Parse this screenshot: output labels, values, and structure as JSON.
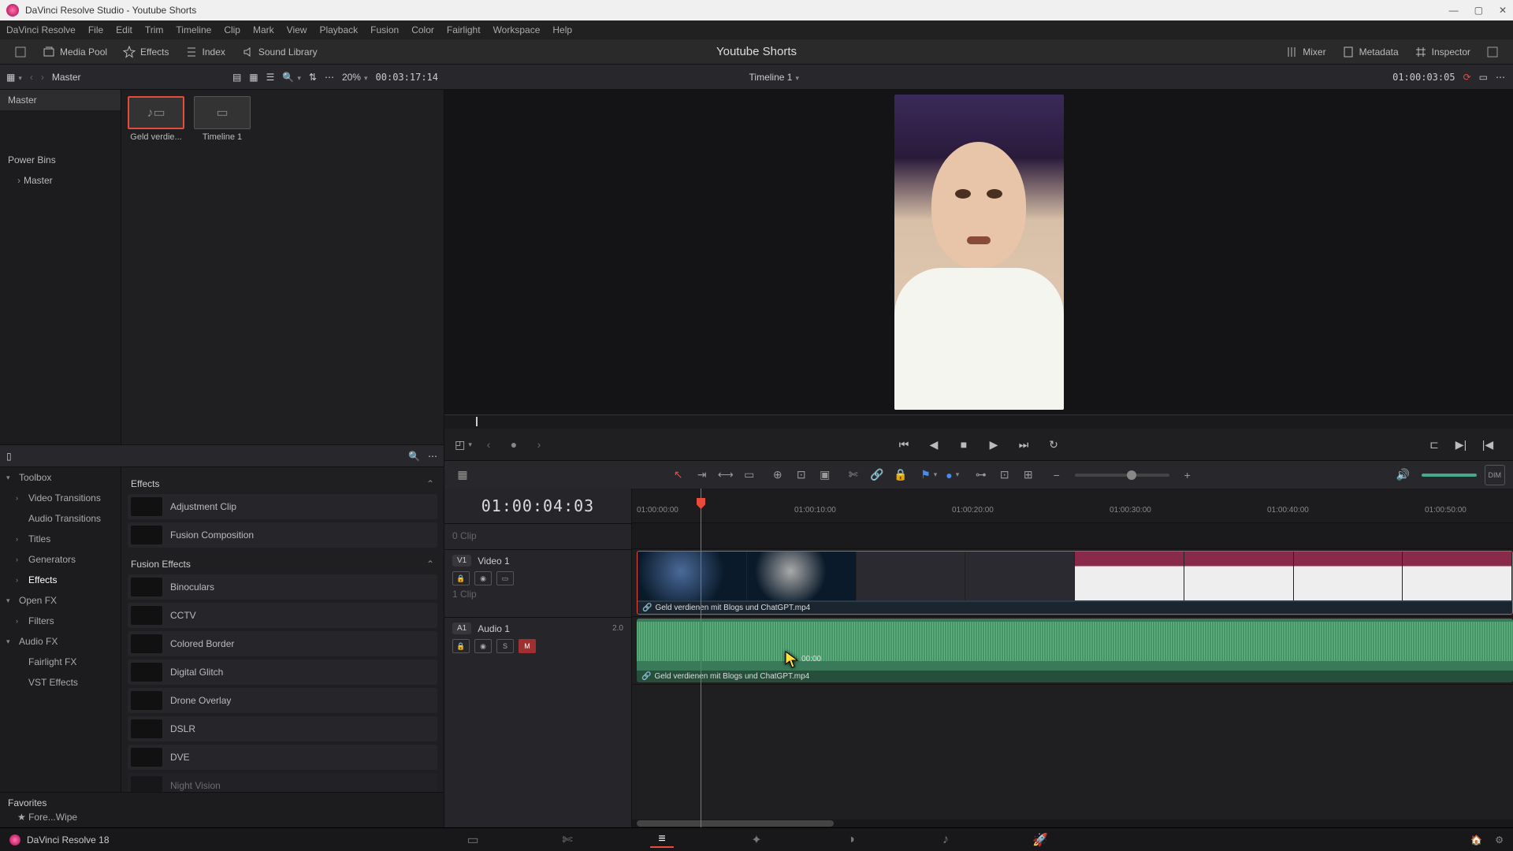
{
  "window": {
    "title": "DaVinci Resolve Studio - Youtube Shorts"
  },
  "menubar": [
    "DaVinci Resolve",
    "File",
    "Edit",
    "Trim",
    "Timeline",
    "Clip",
    "Mark",
    "View",
    "Playback",
    "Fusion",
    "Color",
    "Fairlight",
    "Workspace",
    "Help"
  ],
  "toolbar": {
    "media_pool": "Media Pool",
    "effects": "Effects",
    "index": "Index",
    "sound_library": "Sound Library",
    "project_title": "Youtube Shorts",
    "mixer": "Mixer",
    "metadata": "Metadata",
    "inspector": "Inspector"
  },
  "subheader_left": {
    "breadcrumb": "Master",
    "zoom": "20%",
    "source_tc": "00:03:17:14"
  },
  "subheader_right": {
    "timeline_name": "Timeline 1",
    "viewer_tc": "01:00:03:05"
  },
  "bins": {
    "master": "Master",
    "power_bins": "Power Bins",
    "power_master": "Master"
  },
  "clips": [
    {
      "name": "Geld verdie...",
      "icon": "clip"
    },
    {
      "name": "Timeline 1",
      "icon": "timeline"
    }
  ],
  "fx_tree": {
    "toolbox": "Toolbox",
    "video_transitions": "Video Transitions",
    "audio_transitions": "Audio Transitions",
    "titles": "Titles",
    "generators": "Generators",
    "effects": "Effects",
    "openfx": "Open FX",
    "filters": "Filters",
    "audiofx": "Audio FX",
    "fairlightfx": "Fairlight FX",
    "vst": "VST Effects",
    "favorites": "Favorites",
    "fav1": "Fore...Wipe"
  },
  "fx_list": {
    "group1": "Effects",
    "group2": "Fusion Effects",
    "items1": [
      "Adjustment Clip",
      "Fusion Composition"
    ],
    "items2": [
      "Binoculars",
      "CCTV",
      "Colored Border",
      "Digital Glitch",
      "Drone Overlay",
      "DSLR",
      "DVE",
      "Night Vision"
    ]
  },
  "viewer": {
    "hover_tc": "00:00"
  },
  "timeline": {
    "tc_display": "01:00:04:03",
    "ticks": [
      "01:00:00:00",
      "01:00:10:00",
      "01:00:20:00",
      "01:00:30:00",
      "01:00:40:00",
      "01:00:50:00"
    ],
    "gap_label": "0 Clip",
    "video_track": {
      "badge": "V1",
      "name": "Video 1",
      "clip_count": "1 Clip"
    },
    "audio_track": {
      "badge": "A1",
      "name": "Audio 1",
      "level": "2.0"
    },
    "clip_name": "Geld verdienen mit Blogs und ChatGPT.mp4"
  },
  "footer": {
    "app": "DaVinci Resolve 18"
  }
}
